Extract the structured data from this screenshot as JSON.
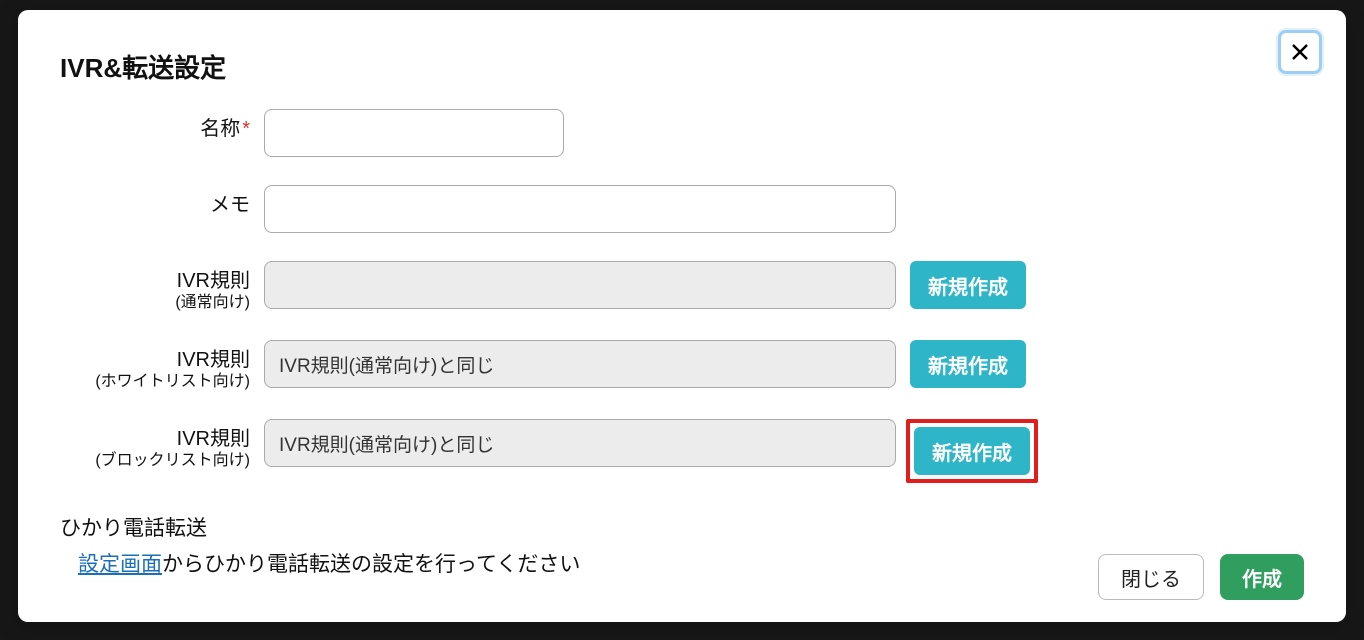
{
  "modal": {
    "title": "IVR&転送設定",
    "fields": {
      "name": {
        "label": "名称",
        "required_mark": "*"
      },
      "memo": {
        "label": "メモ"
      },
      "ivr_normal": {
        "label": "IVR規則",
        "sub": "(通常向け)",
        "value": "",
        "button": "新規作成"
      },
      "ivr_whitelist": {
        "label": "IVR規則",
        "sub": "(ホワイトリスト向け)",
        "value": "IVR規則(通常向け)と同じ",
        "button": "新規作成"
      },
      "ivr_blocklist": {
        "label": "IVR規則",
        "sub": "(ブロックリスト向け)",
        "value": "IVR規則(通常向け)と同じ",
        "button": "新規作成"
      }
    },
    "hikari": {
      "heading": "ひかり電話転送",
      "link": "設定画面",
      "rest": "からひかり電話転送の設定を行ってください"
    },
    "footer": {
      "cancel": "閉じる",
      "submit": "作成"
    }
  }
}
